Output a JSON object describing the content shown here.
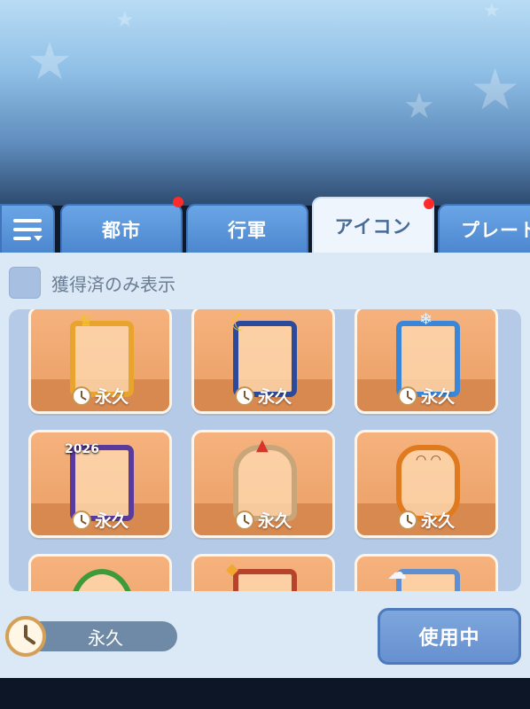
{
  "tabs": {
    "menu_icon": "list-menu-icon",
    "items": [
      {
        "label": "都市",
        "has_notification": true
      },
      {
        "label": "行軍",
        "has_notification": false
      },
      {
        "label": "アイコン",
        "has_notification": true,
        "active": true
      },
      {
        "label": "プレート",
        "has_notification": false
      }
    ]
  },
  "filter": {
    "label": "獲得済のみ表示",
    "checked": false
  },
  "frames": [
    {
      "theme": "3rd-anniversary-frame",
      "duration": "永久",
      "color": "#e8a42c"
    },
    {
      "theme": "moon-night-frame",
      "duration": "永久",
      "color": "#2b4a9c"
    },
    {
      "theme": "snowflake-ice-frame",
      "duration": "永久",
      "color": "#3a86d9"
    },
    {
      "theme": "2026-new-year-frame",
      "duration": "永久",
      "color": "#5a3a9c",
      "badge_text": "2026"
    },
    {
      "theme": "christmas-reindeer-frame",
      "duration": "永久",
      "color": "#d94a3a"
    },
    {
      "theme": "pumpkin-halloween-frame",
      "duration": "永久",
      "color": "#e07a1e"
    },
    {
      "theme": "green-ring-frame",
      "duration": "",
      "color": "#3f9a3a"
    },
    {
      "theme": "lantern-frame",
      "duration": "",
      "color": "#b8432c"
    },
    {
      "theme": "cloud-blue-frame",
      "duration": "",
      "color": "#5e8fd0"
    }
  ],
  "selected": {
    "duration": "永久"
  },
  "actions": {
    "use_label": "使用中"
  },
  "colors": {
    "accent": "#5c8fd6",
    "card": "#f2ad78",
    "notification": "#ff2a2a"
  }
}
